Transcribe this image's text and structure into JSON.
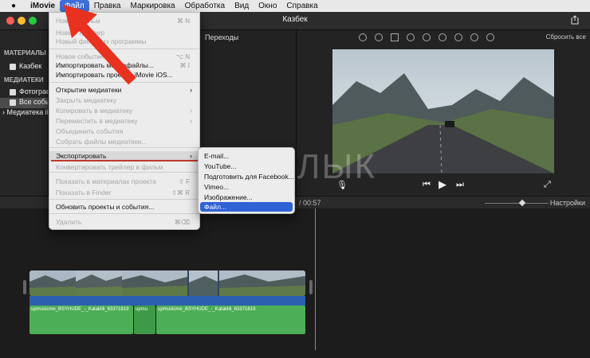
{
  "menubar": {
    "app": "iMovie",
    "items": [
      "Файл",
      "Правка",
      "Маркировка",
      "Обработка",
      "Вид",
      "Окно",
      "Справка"
    ]
  },
  "window": {
    "title": "Казбек"
  },
  "sidebar": {
    "section_materials": "МАТЕРИАЛЫ ПРОЕ",
    "project_item": "Казбек",
    "section_libraries": "МЕДИАТЕКИ",
    "items": [
      "Фотограф",
      "Все событ",
      "Медиатека iMo"
    ]
  },
  "browser": {
    "tab_transitions": "Переходы"
  },
  "viewer": {
    "reset_label": "Сбросить все"
  },
  "timeline": {
    "timecode": "/ 00:57",
    "settings_label": "Настройки",
    "audio_clips": [
      "upmusicme_BSYHUDE_-_Kataklili_63371819",
      "upmu",
      "upmusicme_BSYHUDE_-_Kataklili_63371819"
    ]
  },
  "watermark": "ЯБЛЫК",
  "file_menu": {
    "items": [
      {
        "label": "Новый фильм",
        "shortcut": "⌘ N",
        "disabled": true
      },
      {
        "label": "Новый трейлер",
        "shortcut": "",
        "disabled": true
      },
      {
        "label": "Новый фильм из программы",
        "shortcut": "",
        "disabled": true
      },
      {
        "label": "Новое событие",
        "shortcut": "⌥ N",
        "disabled": true
      },
      {
        "label": "Импортировать медиафайлы...",
        "shortcut": "⌘ I",
        "disabled": false
      },
      {
        "label": "Импортировать проекты iMovie iOS...",
        "shortcut": "",
        "disabled": false
      },
      {
        "label": "Открытие медиатеки",
        "shortcut": "›",
        "disabled": false
      },
      {
        "label": "Закрыть медиатеку",
        "shortcut": "",
        "disabled": true
      },
      {
        "label": "Копировать в медиатеку",
        "shortcut": "›",
        "disabled": true
      },
      {
        "label": "Переместить в медиатеку",
        "shortcut": "›",
        "disabled": true
      },
      {
        "label": "Объединить события",
        "shortcut": "",
        "disabled": true
      },
      {
        "label": "Собрать файлы медиатеки...",
        "shortcut": "",
        "disabled": true
      },
      {
        "label": "Экспортировать",
        "shortcut": "›",
        "disabled": false
      },
      {
        "label": "Конвертировать трейлер в фильм",
        "shortcut": "",
        "disabled": true
      },
      {
        "label": "Показать в материалах проекта",
        "shortcut": "⇧ F",
        "disabled": true
      },
      {
        "label": "Показать в Finder",
        "shortcut": "⇧⌘ R",
        "disabled": true
      },
      {
        "label": "Обновить проекты и события...",
        "shortcut": "",
        "disabled": false
      },
      {
        "label": "Удалить",
        "shortcut": "⌘⌫",
        "disabled": true
      }
    ]
  },
  "export_submenu": {
    "items": [
      "E-mail...",
      "YouTube...",
      "Подготовить для Facebook...",
      "Vimeo...",
      "Изображение...",
      "Файл..."
    ],
    "selected": "Файл..."
  },
  "colors": {
    "menu_highlight": "#2f62d4",
    "arrow": "#e8311f",
    "underline": "#c0392b"
  }
}
